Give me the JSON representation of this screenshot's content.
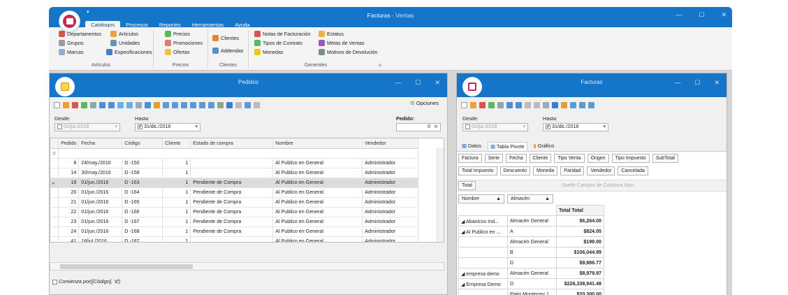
{
  "app": {
    "title": "Facturas",
    "title_sub": " - Ventas",
    "qat": "▾"
  },
  "tabs": [
    "Catálogos",
    "Procesos",
    "Reportes",
    "Herramientas",
    "Ayuda"
  ],
  "ribbon": {
    "articulos": {
      "label": "Artículos",
      "items": [
        "Departamentos",
        "Artículos",
        "Grupos",
        "Unidades",
        "Marcas",
        "Especificaciones"
      ]
    },
    "precios": {
      "label": "Precios",
      "items": [
        "Precios",
        "Promociones",
        "Ofertas"
      ]
    },
    "clientes": {
      "label": "Clientes",
      "items": [
        "Clientes",
        "Addendas"
      ]
    },
    "generales": {
      "label": "Generales",
      "items": [
        "Notas de Facturación",
        "Estatus",
        "Tipos de Contrato",
        "Metas de Ventas",
        "Monedas",
        "Motivos de Devolución"
      ]
    }
  },
  "pedidos": {
    "title": "Pedidos",
    "opciones": "Opciones",
    "desde_label": "Desde:",
    "desde_value": "01/jul./2018",
    "hasta_label": "Hasta:",
    "hasta_value": "31/dic./2018",
    "pedido_label": "Pedido:",
    "pedido_value": "0",
    "columns": [
      "Pedido",
      "Fecha",
      "Código",
      "Cliente",
      "Estado de compra",
      "Nombre",
      "Vendedor"
    ],
    "rows": [
      [
        "8",
        "24/may./2016",
        "D -150",
        "1",
        "",
        "Al Publico en General",
        "Administrador"
      ],
      [
        "14",
        "30/may./2016",
        "D -158",
        "1",
        "",
        "Al Publico en General",
        "Administrador"
      ],
      [
        "19",
        "01/jun./2016",
        "D -163",
        "1",
        "Pendiente de Compra",
        "Al Publico en General",
        "Administrador"
      ],
      [
        "20",
        "01/jun./2016",
        "D -164",
        "1",
        "Pendiente de Compra",
        "Al Publico en General",
        "Administrador"
      ],
      [
        "21",
        "01/jun./2016",
        "D -165",
        "1",
        "Pendiente de Compra",
        "Al Publico en General",
        "Administrador"
      ],
      [
        "22",
        "01/jun./2016",
        "D -166",
        "1",
        "Pendiente de Compra",
        "Al Publico en General",
        "Administrador"
      ],
      [
        "23",
        "01/jun./2016",
        "D -167",
        "1",
        "Pendiente de Compra",
        "Al Publico en General",
        "Administrador"
      ],
      [
        "24",
        "01/jun./2016",
        "D -168",
        "1",
        "Pendiente de Compra",
        "Al Publico en General",
        "Administrador"
      ],
      [
        "41",
        "18/jul./2016",
        "D -187",
        "1",
        "",
        "Al Publico en General",
        "Administrador"
      ]
    ],
    "selected_row": 2,
    "filter": "Comienza por([Código], 'd')"
  },
  "facturas": {
    "title": "Facturas",
    "desde_label": "Desde:",
    "desde_value": "01/jul./2018",
    "hasta_label": "Hasta:",
    "hasta_value": "31/dic./2018",
    "tabs": [
      "Datos",
      "Tabla Pivote",
      "Gráfico"
    ],
    "fields_row1": [
      "Factura",
      "Serie",
      "Fecha",
      "Cliente",
      "Tipo Venta",
      "Origen",
      "Tipo Impuesto",
      "SubTotal"
    ],
    "fields_row2": [
      "Total Impuesto",
      "Descuento",
      "Moneda",
      "Paridad",
      "Vendedor",
      "Cancelada"
    ],
    "data_field": "Total",
    "drop_hint": "Suelte Campos de Columna Aquí",
    "row_fields": [
      "Nombre",
      "Almacén"
    ],
    "total_header": "Total Total",
    "pivot": [
      [
        "◢ Abanicos Ind...",
        "Almacén General",
        "$6,264.00"
      ],
      [
        "◢ Al Publico en ...",
        "A",
        "$824.05"
      ],
      [
        "",
        "Almacén General",
        "$199.00"
      ],
      [
        "",
        "B",
        "$106,044.99"
      ],
      [
        "",
        "D",
        "$9,886.77"
      ],
      [
        "◢ empresa demo",
        "Almacén General",
        "$8,979.97"
      ],
      [
        "◢ Empresa Demo",
        "D",
        "$226,338,941.48"
      ],
      [
        "",
        "Patio Monterrey 1",
        "$20,300.00"
      ]
    ]
  },
  "colors": {
    "accent": "#1575c9",
    "orb": "#c6284d"
  }
}
